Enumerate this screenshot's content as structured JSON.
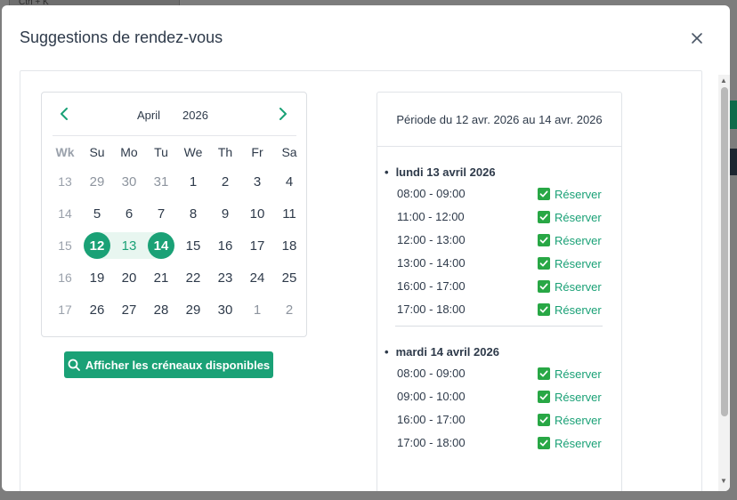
{
  "background": {
    "search_shortcut": "Ctrl + K"
  },
  "modal": {
    "title": "Suggestions de rendez-vous"
  },
  "calendar": {
    "month": "April",
    "year": "2026",
    "weekday_headers": [
      "Wk",
      "Su",
      "Mo",
      "Tu",
      "We",
      "Th",
      "Fr",
      "Sa"
    ],
    "weeks": [
      {
        "wk": "13",
        "days": [
          {
            "d": "29",
            "muted": true
          },
          {
            "d": "30",
            "muted": true
          },
          {
            "d": "31",
            "muted": true
          },
          {
            "d": "1"
          },
          {
            "d": "2"
          },
          {
            "d": "3"
          },
          {
            "d": "4"
          }
        ]
      },
      {
        "wk": "14",
        "days": [
          {
            "d": "5"
          },
          {
            "d": "6"
          },
          {
            "d": "7"
          },
          {
            "d": "8"
          },
          {
            "d": "9"
          },
          {
            "d": "10"
          },
          {
            "d": "11"
          }
        ]
      },
      {
        "wk": "15",
        "days": [
          {
            "d": "12",
            "state": "selected-start"
          },
          {
            "d": "13",
            "state": "in-range"
          },
          {
            "d": "14",
            "state": "selected-end"
          },
          {
            "d": "15"
          },
          {
            "d": "16"
          },
          {
            "d": "17"
          },
          {
            "d": "18"
          }
        ]
      },
      {
        "wk": "16",
        "days": [
          {
            "d": "19"
          },
          {
            "d": "20"
          },
          {
            "d": "21"
          },
          {
            "d": "22"
          },
          {
            "d": "23"
          },
          {
            "d": "24"
          },
          {
            "d": "25"
          }
        ]
      },
      {
        "wk": "17",
        "days": [
          {
            "d": "26"
          },
          {
            "d": "27"
          },
          {
            "d": "28"
          },
          {
            "d": "29"
          },
          {
            "d": "30"
          },
          {
            "d": "1",
            "muted": true
          },
          {
            "d": "2",
            "muted": true
          }
        ]
      }
    ],
    "show_button_label": "Afficher les créneaux disponibles"
  },
  "slots": {
    "period_label": "Période du 12 avr. 2026 au 14 avr. 2026",
    "book_label": "Réserver",
    "days": [
      {
        "title": "lundi 13 avril 2026",
        "times": [
          "08:00 - 09:00",
          "11:00 - 12:00",
          "12:00 - 13:00",
          "13:00 - 14:00",
          "16:00 - 17:00",
          "17:00 - 18:00"
        ]
      },
      {
        "title": "mardi 14 avril 2026",
        "times": [
          "08:00 - 09:00",
          "09:00 - 10:00",
          "16:00 - 17:00",
          "17:00 - 18:00"
        ]
      }
    ]
  },
  "colors": {
    "accent": "#1aa176",
    "check": "#28a745",
    "text": "#2e3a4a",
    "muted": "#8d949e"
  }
}
